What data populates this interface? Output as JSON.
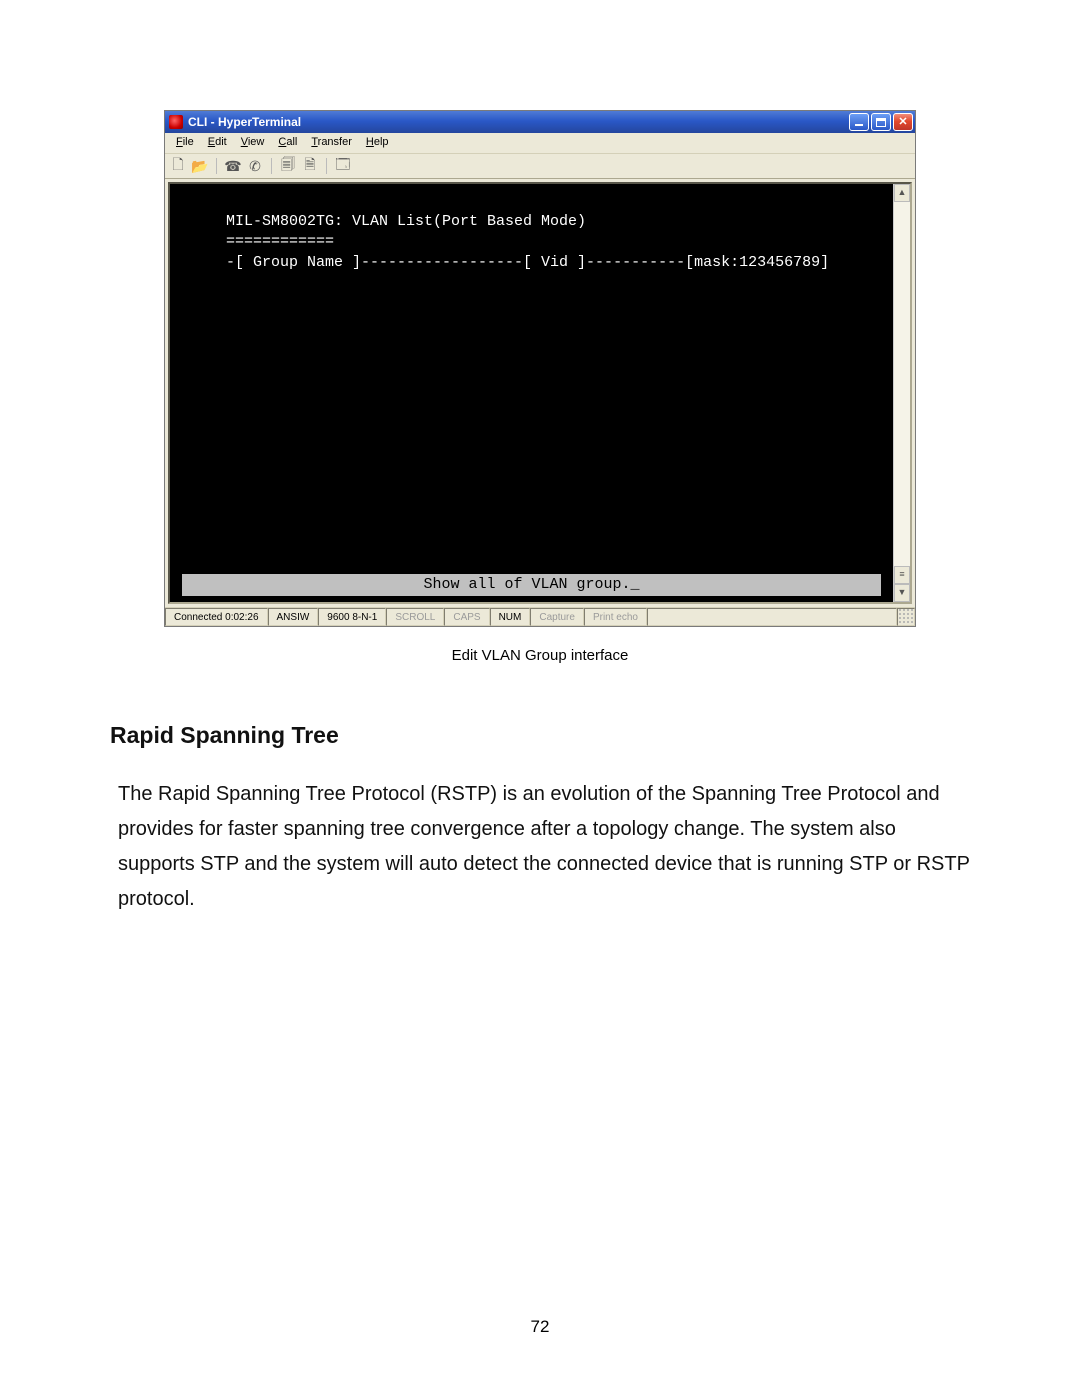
{
  "window": {
    "title": "CLI - HyperTerminal"
  },
  "menubar": {
    "file": "File",
    "edit": "Edit",
    "view": "View",
    "call": "Call",
    "transfer": "Transfer",
    "help": "Help"
  },
  "terminal": {
    "line1": "MIL-SM8002TG: VLAN List(Port Based Mode)",
    "line2": "============",
    "line3": "-[ Group Name ]------------------[ Vid ]-----------[mask:123456789]",
    "footer": "Show all of VLAN group._"
  },
  "statusbar": {
    "connected": "Connected 0:02:26",
    "term": "ANSIW",
    "port": "9600 8-N-1",
    "scroll": "SCROLL",
    "caps": "CAPS",
    "num": "NUM",
    "capture": "Capture",
    "printecho": "Print echo"
  },
  "caption": "Edit VLAN Group interface",
  "heading": "Rapid Spanning Tree",
  "body": "The Rapid Spanning Tree Protocol (RSTP) is an evolution of the Spanning Tree Protocol and provides for faster spanning tree convergence after a topology change. The system also supports STP and the system will auto detect the connected device that is running STP or RSTP protocol.",
  "page_number": "72"
}
